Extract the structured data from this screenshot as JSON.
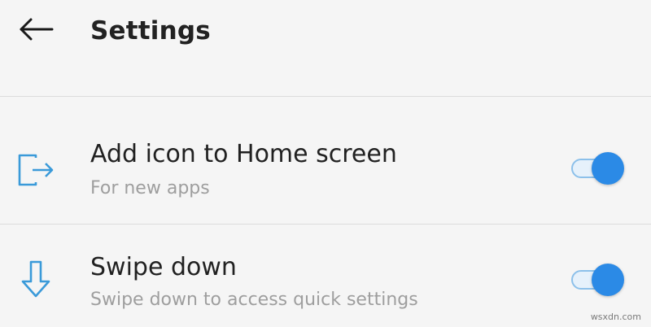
{
  "header": {
    "back_icon": "arrow-left-icon",
    "title": "Settings"
  },
  "settings": [
    {
      "icon": "exit-to-app-icon",
      "title": "Add icon to Home screen",
      "subtitle": "For new apps",
      "enabled": true
    },
    {
      "icon": "arrow-down-icon",
      "title": "Swipe down",
      "subtitle": "Swipe down to access quick settings",
      "enabled": true
    }
  ],
  "colors": {
    "accent": "#2b8ae6",
    "icon_tint": "#3a9ad9",
    "title_text": "#212121",
    "subtitle_text": "#9e9e9e",
    "background": "#f5f5f5"
  },
  "watermark": "wsxdn.com"
}
